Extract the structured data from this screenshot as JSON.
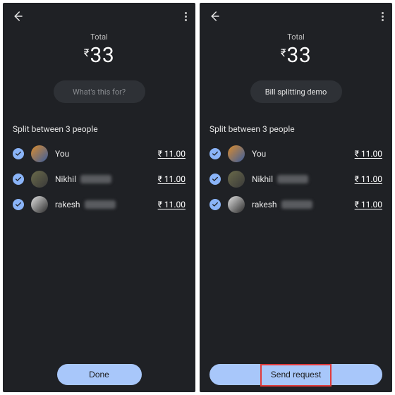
{
  "colors": {
    "bg": "#1f2125",
    "accent": "#a8c7fa",
    "check": "#8ab4f8",
    "highlight": "#e03a3a"
  },
  "shared": {
    "total_label": "Total",
    "currency": "₹",
    "amount": "33",
    "split_header": "Split between 3 people",
    "people": [
      {
        "name": "You",
        "amount": "₹ 11.00",
        "avatar": "you",
        "obscured": false
      },
      {
        "name": "Nikhil",
        "amount": "₹ 11.00",
        "avatar": "p2",
        "obscured": true
      },
      {
        "name": "rakesh",
        "amount": "₹ 11.00",
        "avatar": "p3",
        "obscured": true
      }
    ]
  },
  "left": {
    "note_placeholder": "What's this for?",
    "note_value": "",
    "action_label": "Done"
  },
  "right": {
    "note_placeholder": "",
    "note_value": "Bill splitting demo",
    "action_label": "Send request",
    "highlight_action": true
  }
}
